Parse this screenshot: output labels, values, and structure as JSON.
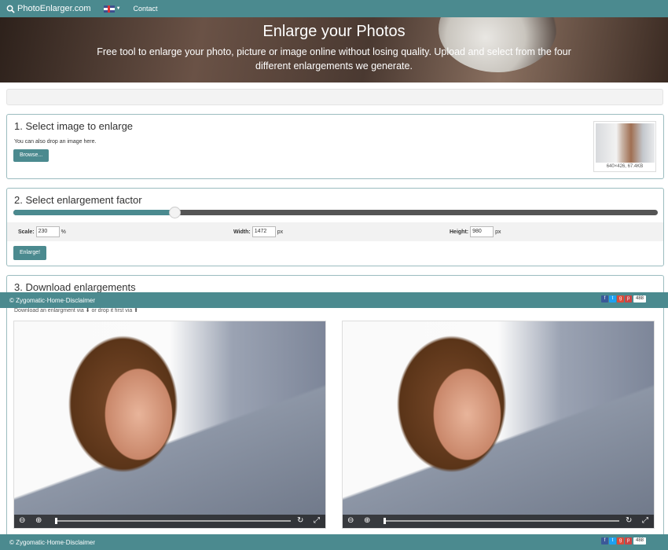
{
  "navbar": {
    "brand": "PhotoEnlarger.com",
    "contact": "Contact",
    "language_flag": "uk-flag-icon"
  },
  "hero": {
    "title": "Enlarge your Photos",
    "subtitle": "Free tool to enlarge your photo, picture or image online without losing quality. Upload and select from the four different enlargements we generate."
  },
  "select": {
    "title": "1. Select image to enlarge",
    "hint": "You can also drop an image here.",
    "browse_label": "Browse...",
    "thumbnail_meta": "640×426, 67.4KB"
  },
  "factor": {
    "title": "2. Select enlargement factor",
    "slider_fraction": 0.25,
    "scale_label": "Scale:",
    "scale_value": "230",
    "scale_unit": "%",
    "width_label": "Width:",
    "width_value": "1472",
    "width_unit": "px",
    "height_label": "Height:",
    "height_value": "980",
    "height_unit": "px",
    "enlarge_label": "Enlarge!"
  },
  "download": {
    "title": "3. Download enlargements",
    "note": "Download an enlargment via ⬇ or drop it first via ⬆"
  },
  "footer": {
    "copyright": "© Zygomatic",
    "sep1": " · ",
    "home": "Home",
    "sep2": " · ",
    "disclaimer": "Disclaimer",
    "share_count": "488"
  },
  "colors": {
    "accent": "#4b8a8f",
    "facebook": "#3b5998",
    "twitter": "#1da1f2",
    "googleplus": "#dd4b39",
    "pinterest": "#c44"
  }
}
